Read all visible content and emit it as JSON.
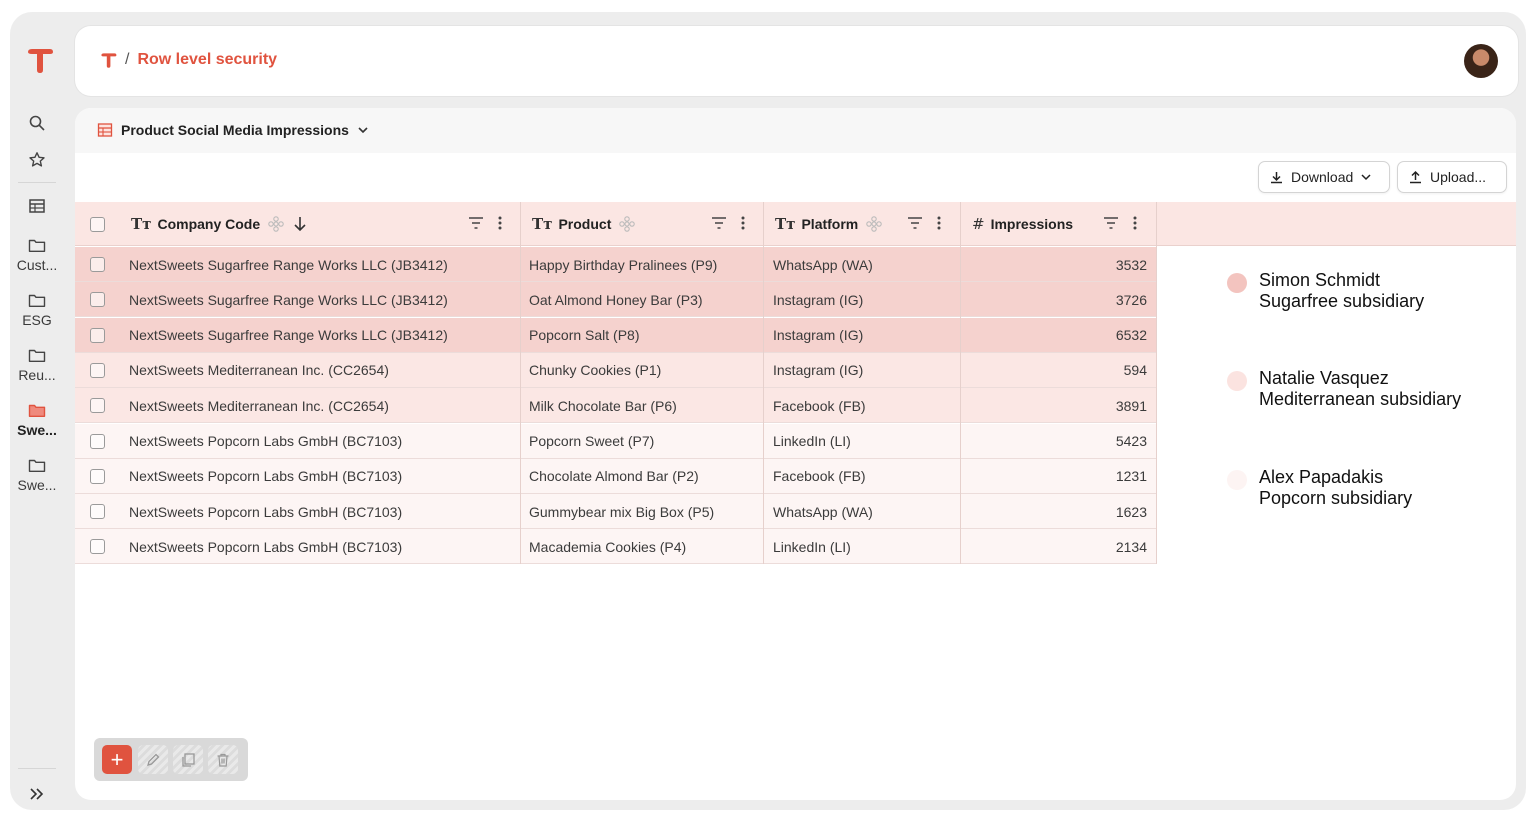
{
  "header": {
    "breadcrumb_sep": "/",
    "title": "Row level security"
  },
  "sidebar": {
    "folders": [
      {
        "label": "Cust..."
      },
      {
        "label": "ESG"
      },
      {
        "label": "Reu..."
      },
      {
        "label": "Swe..."
      },
      {
        "label": "Swe..."
      }
    ]
  },
  "main": {
    "table_title": "Product Social Media Impressions",
    "download_label": "Download",
    "upload_label": "Upload..."
  },
  "table": {
    "columns": [
      "Company Code",
      "Product",
      "Platform",
      "Impressions"
    ],
    "type_glyph": "Tт",
    "number_glyph": "#",
    "rows": [
      {
        "company": "NextSweets Sugarfree Range Works LLC (JB3412)",
        "product": "Happy Birthday Pralinees (P9)",
        "platform": "WhatsApp (WA)",
        "impressions": "3532"
      },
      {
        "company": "NextSweets Sugarfree Range Works LLC (JB3412)",
        "product": "Oat Almond Honey Bar (P3)",
        "platform": "Instagram (IG)",
        "impressions": "3726"
      },
      {
        "company": "NextSweets Sugarfree Range Works LLC (JB3412)",
        "product": "Popcorn Salt (P8)",
        "platform": "Instagram (IG)",
        "impressions": "6532"
      },
      {
        "company": "NextSweets Mediterranean Inc. (CC2654)",
        "product": "Chunky Cookies (P1)",
        "platform": "Instagram (IG)",
        "impressions": "594"
      },
      {
        "company": "NextSweets Mediterranean Inc. (CC2654)",
        "product": "Milk Chocolate Bar (P6)",
        "platform": "Facebook (FB)",
        "impressions": "3891"
      },
      {
        "company": "NextSweets Popcorn Labs GmbH (BC7103)",
        "product": "Popcorn Sweet (P7)",
        "platform": "LinkedIn (LI)",
        "impressions": "5423"
      },
      {
        "company": "NextSweets Popcorn Labs GmbH (BC7103)",
        "product": "Chocolate Almond Bar (P2)",
        "platform": "Facebook (FB)",
        "impressions": "1231"
      },
      {
        "company": "NextSweets Popcorn Labs GmbH (BC7103)",
        "product": "Gummybear mix Big Box (P5)",
        "platform": "WhatsApp (WA)",
        "impressions": "1623"
      },
      {
        "company": "NextSweets Popcorn Labs GmbH (BC7103)",
        "product": "Macademia Cookies (P4)",
        "platform": "LinkedIn (LI)",
        "impressions": "2134"
      }
    ]
  },
  "legend": [
    {
      "name": "Simon Schmidt",
      "role": "Sugarfree subsidiary",
      "color": "#f3c4bf"
    },
    {
      "name": "Natalie Vasquez",
      "role": "Mediterranean subsidiary",
      "color": "#fbe3e0"
    },
    {
      "name": "Alex Papadakis",
      "role": "Popcorn subsidiary",
      "color": "#fdf4f3"
    }
  ],
  "colors": {
    "accent": "#e0533f",
    "row_sugarfree": "#f5d2ce",
    "row_mediterranean": "#fbe7e4",
    "row_popcorn": "#fdf5f4"
  },
  "toolbar": {
    "add_label": "+"
  }
}
